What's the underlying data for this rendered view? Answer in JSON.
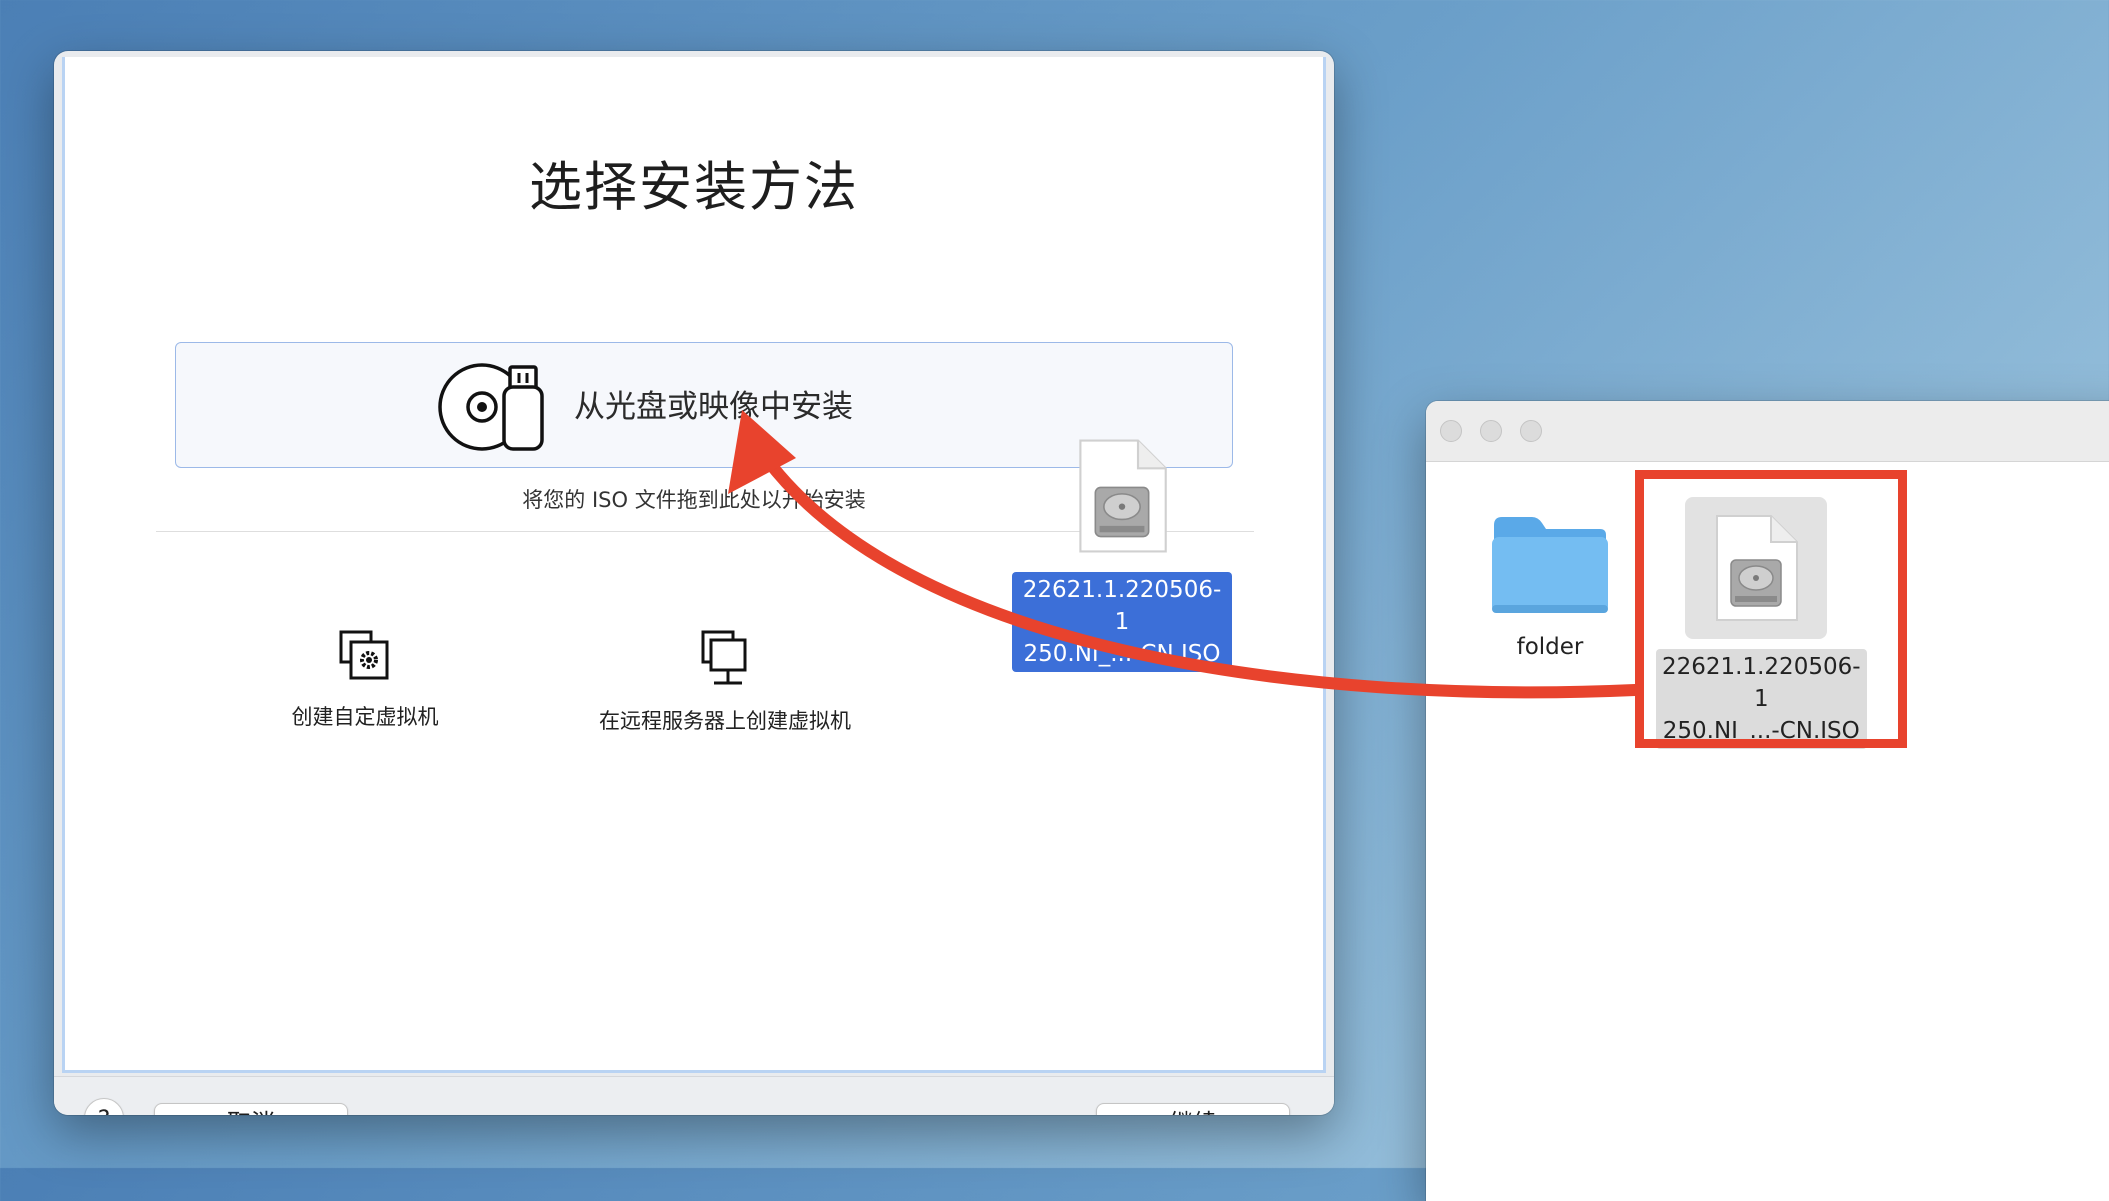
{
  "installer": {
    "title": "选择安装方法",
    "install_option": {
      "label": "从光盘或映像中安装",
      "icon": "disc-usb-icon"
    },
    "drop_hint": "将您的 ISO 文件拖到此处以开始安装",
    "options": [
      {
        "label": "创建自定虚拟机",
        "icon": "custom-vm-icon"
      },
      {
        "label": "在远程服务器上创建虚拟机",
        "icon": "remote-vm-icon"
      }
    ],
    "footer": {
      "help_label": "?",
      "cancel_label": "取消",
      "continue_label": "继续"
    }
  },
  "drag": {
    "file_name": "22621.1.220506-1\n250.NI_...-CN.ISO",
    "icon": "disk-image-icon"
  },
  "finder": {
    "items": [
      {
        "name": "folder",
        "icon": "folder-icon"
      },
      {
        "name": "22621.1.220506-1\n250.NI_...-CN.ISO",
        "icon": "disk-image-icon"
      }
    ]
  },
  "colors": {
    "accent": "#3c6fd8",
    "highlight": "#e8432d",
    "arrow": "#e8432d",
    "folder": "#64b3ef"
  }
}
